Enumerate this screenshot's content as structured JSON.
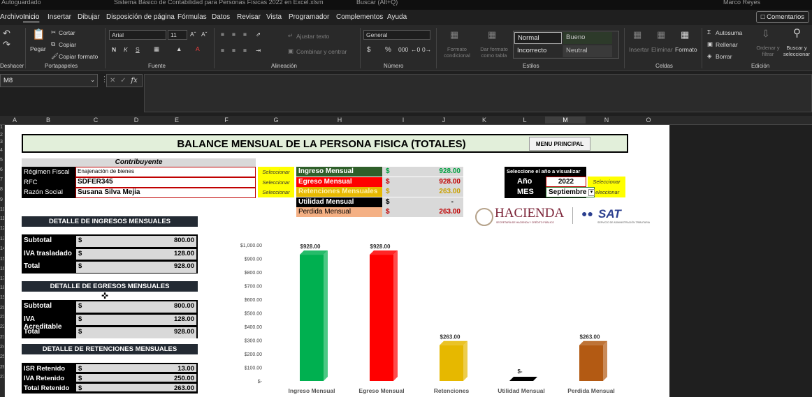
{
  "titlebar": {
    "autosave": "Autoguardado",
    "title": "Sistema Básico de Contabilidad para Personas Físicas 2022 en Excel.xlsm",
    "search": "Buscar (Alt+Q)",
    "user": "Marco Reyes"
  },
  "menu": {
    "items": [
      "Archivo",
      "Inicio",
      "Insertar",
      "Dibujar",
      "Disposición de página",
      "Fórmulas",
      "Datos",
      "Revisar",
      "Vista",
      "Programador",
      "Complementos",
      "Ayuda"
    ],
    "comments": "Comentarios"
  },
  "ribbon": {
    "undo_label": "Deshacer",
    "clipboard": {
      "paste": "Pegar",
      "cut": "Cortar",
      "copy": "Copiar",
      "format_painter": "Copiar formato",
      "label": "Portapapeles"
    },
    "font": {
      "family": "Arial",
      "size": "11",
      "bold": "N",
      "italic": "K",
      "underline": "S",
      "label": "Fuente"
    },
    "alignment": {
      "wrap": "Ajustar texto",
      "merge": "Combinar y centrar",
      "label": "Alineación"
    },
    "number": {
      "format": "General",
      "currency": "$",
      "percent": "%",
      "label": "Número"
    },
    "styles": {
      "cond_format": "Formato condicional",
      "as_table": "Dar formato como tabla",
      "normal": "Normal",
      "bueno": "Bueno",
      "incorrecto": "Incorrecto",
      "neutral": "Neutral",
      "label": "Estilos"
    },
    "cells": {
      "insert": "Insertar",
      "delete": "Eliminar",
      "format": "Formato",
      "label": "Celdas"
    },
    "editing": {
      "autosum": "Autosuma",
      "fill": "Rellenar",
      "clear": "Borrar",
      "sort": "Ordenar y filtrar",
      "find": "Buscar y seleccionar",
      "label": "Edición"
    }
  },
  "formula_bar": {
    "name_box": "M8",
    "fx": "fx",
    "formula": ""
  },
  "columns": [
    "A",
    "B",
    "C",
    "D",
    "E",
    "F",
    "G",
    "H",
    "I",
    "J",
    "K",
    "L",
    "M",
    "N",
    "O"
  ],
  "selected_column": "M",
  "rows": [
    "1",
    "2",
    "3",
    "4",
    "5",
    "6",
    "7",
    "8",
    "9",
    "10",
    "11",
    "12",
    "13",
    "14",
    "15",
    "16",
    "17",
    "18",
    "19",
    "20",
    "21",
    "22",
    "23",
    "24",
    "25",
    "26",
    "27"
  ],
  "sheet": {
    "title": "BALANCE MENSUAL DE LA PERSONA FISICA (TOTALES)",
    "menu_button": "MENU PRINCIPAL",
    "contribuyente": {
      "header": "Contribuyente",
      "regimen_label": "Régimen Fiscal",
      "regimen_value": "Enajenación de bienes",
      "rfc_label": "RFC",
      "rfc_value": "SDFER345",
      "razon_label": "Razón Social",
      "razon_value": "Susana Silva Mejia",
      "select": "Seleccionar"
    },
    "kpis": [
      {
        "label": "Ingreso Mensual",
        "currency": "$",
        "value": "928.00"
      },
      {
        "label": "Egreso Mensual",
        "currency": "$",
        "value": "928.00"
      },
      {
        "label": "Retenciones Mensuales",
        "currency": "$",
        "value": "263.00"
      },
      {
        "label": "Utilidad Mensual",
        "currency": "$",
        "value": "-"
      },
      {
        "label": "Perdida Mensual",
        "currency": "$",
        "value": "263.00"
      }
    ],
    "period": {
      "header": "Seleccione el año a visualizar",
      "year_label": "Año",
      "year_value": "2022",
      "month_label": "MES",
      "month_value": "Septiembre",
      "select": "Seleccionar",
      "select2": "eleccionar"
    },
    "logos": {
      "hacienda": "HACIENDA",
      "hacienda_sub": "SECRETARÍA DE HACIENDA Y CRÉDITO PÚBLICO",
      "sat": "SAT",
      "sat_sub": "SERVICIO DE ADMINISTRACIÓN TRIBUTARIA"
    },
    "ingresos": {
      "header": "DETALLE DE INGRESOS MENSUALES",
      "rows": [
        {
          "label": "Subtotal",
          "currency": "$",
          "value": "800.00"
        },
        {
          "label": "IVA trasladado",
          "currency": "$",
          "value": "128.00"
        },
        {
          "label": "Total",
          "currency": "$",
          "value": "928.00"
        }
      ]
    },
    "egresos": {
      "header": "DETALLE DE EGRESOS MENSUALES",
      "rows": [
        {
          "label": "Subtotal",
          "currency": "$",
          "value": "800.00"
        },
        {
          "label": "IVA Acreditable",
          "currency": "$",
          "value": "128.00"
        },
        {
          "label": "Total",
          "currency": "$",
          "value": "928.00"
        }
      ]
    },
    "retenciones": {
      "header": "DETALLE DE RETENCIONES MENSUALES",
      "rows": [
        {
          "label": "ISR Retenido",
          "currency": "$",
          "value": "13.00"
        },
        {
          "label": "IVA Retenido",
          "currency": "$",
          "value": "250.00"
        },
        {
          "label": "Total Retenido",
          "currency": "$",
          "value": "263.00"
        }
      ]
    }
  },
  "chart_data": {
    "type": "bar",
    "categories": [
      "Ingreso Mensual",
      "Egreso Mensual",
      "Retenciones",
      "Utilidad Mensual",
      "Perdida Mensual"
    ],
    "values": [
      928,
      928,
      263,
      0,
      263
    ],
    "data_labels": [
      "$928.00",
      "$928.00",
      "$263.00",
      "$-",
      "$263.00"
    ],
    "colors": [
      "#00b050",
      "#ff0000",
      "#e6b800",
      "#000000",
      "#b35a13"
    ],
    "ylim": [
      0,
      1000
    ],
    "yticks": [
      "$-",
      "$100.00",
      "$200.00",
      "$300.00",
      "$400.00",
      "$500.00",
      "$600.00",
      "$700.00",
      "$800.00",
      "$900.00",
      "$1,000.00"
    ],
    "title": "",
    "grid": false,
    "legend": "none"
  }
}
